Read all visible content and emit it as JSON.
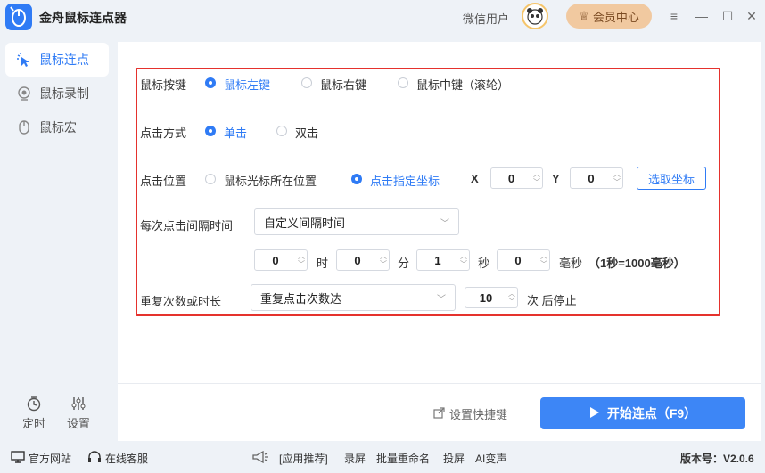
{
  "app": {
    "title": "金舟鼠标连点器",
    "user": "微信用户",
    "vip_label": "会员中心"
  },
  "window": {
    "menu": "≡",
    "minimize": "—",
    "maximize": "☐",
    "close": "✕"
  },
  "sidebar": {
    "items": [
      {
        "label": "鼠标连点",
        "icon": "click-cursor-icon",
        "active": true
      },
      {
        "label": "鼠标录制",
        "icon": "record-icon",
        "active": false
      },
      {
        "label": "鼠标宏",
        "icon": "mouse-icon",
        "active": false
      }
    ],
    "bottom": [
      {
        "label": "定时",
        "icon": "clock-icon"
      },
      {
        "label": "设置",
        "icon": "sliders-icon"
      }
    ]
  },
  "form": {
    "mouse_button": {
      "label": "鼠标按键",
      "options": [
        "鼠标左键",
        "鼠标右键",
        "鼠标中键（滚轮）"
      ],
      "selected": 0
    },
    "click_mode": {
      "label": "点击方式",
      "options": [
        "单击",
        "双击"
      ],
      "selected": 0
    },
    "click_pos": {
      "label": "点击位置",
      "options": [
        "鼠标光标所在位置",
        "点击指定坐标"
      ],
      "selected": 1,
      "x_label": "X",
      "x_value": "0",
      "y_label": "Y",
      "y_value": "0",
      "pick_button": "选取坐标"
    },
    "interval": {
      "label": "每次点击间隔时间",
      "mode": "自定义间隔时间",
      "hours": "0",
      "hours_unit": "时",
      "minutes": "0",
      "minutes_unit": "分",
      "seconds": "1",
      "seconds_unit": "秒",
      "ms": "0",
      "ms_unit": "毫秒",
      "hint": "（1秒=1000毫秒）"
    },
    "repeat": {
      "label": "重复次数或时长",
      "mode": "重复点击次数达",
      "count": "10",
      "suffix": "次 后停止"
    }
  },
  "actions": {
    "shortcut": "设置快捷键",
    "start": "开始连点（F9）"
  },
  "footer": {
    "website": "官方网站",
    "support": "在线客服",
    "recommend": "[应用推荐]",
    "links": [
      "录屏",
      "批量重命名",
      "投屏",
      "AI变声"
    ],
    "version": "版本号：V2.0.6"
  },
  "colors": {
    "accent": "#2f7bf5",
    "highlight_border": "#e5322d",
    "vip_bg": "#f1c9a0"
  }
}
